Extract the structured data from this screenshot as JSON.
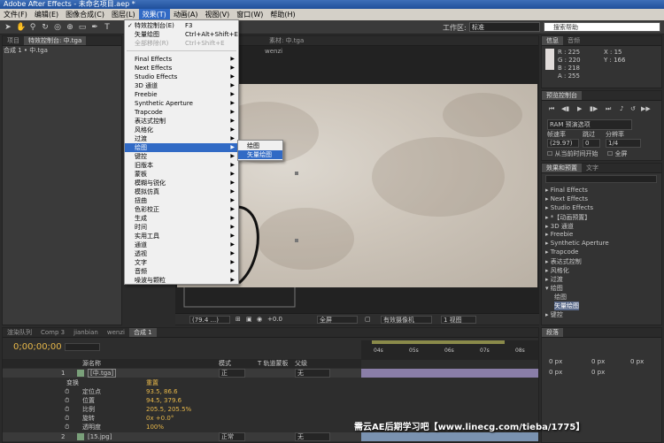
{
  "window": {
    "title": "Adobe After Effects - 未命名项目.aep *"
  },
  "menubar": {
    "items": [
      "文件(F)",
      "编辑(E)",
      "图像合成(C)",
      "图层(L)",
      "效果(T)",
      "动画(A)",
      "视图(V)",
      "窗口(W)",
      "帮助(H)"
    ]
  },
  "toolbar": {
    "workspace_label": "工作区:",
    "workspace_value": "标准",
    "search_placeholder": "搜索帮助"
  },
  "left_panel": {
    "tabs": [
      "项目",
      "特效控制台: 中.tga"
    ],
    "comp_path": "合成 1 • 中.tga"
  },
  "viewer": {
    "tabs": [
      "素材: 中.tga"
    ],
    "layer_label": "wenzi",
    "footer": {
      "zoom": "(79.4 ...)",
      "resolution": "全屏",
      "camera": "有效摄像机",
      "views": "1 视图",
      "exposure": "+0.0"
    }
  },
  "effect_menu": {
    "items": [
      {
        "label": "特效控制台(E)",
        "shortcut": "F3",
        "checked": true
      },
      {
        "label": "矢量绘图",
        "shortcut": "Ctrl+Alt+Shift+E"
      },
      {
        "label": "全部移除(R)",
        "shortcut": "Ctrl+Shift+E",
        "disabled": true
      },
      {
        "label": "Final Effects",
        "arrow": true
      },
      {
        "label": "Next Effects",
        "arrow": true
      },
      {
        "label": "Studio Effects",
        "arrow": true
      },
      {
        "label": "3D 通道",
        "arrow": true
      },
      {
        "label": "Freebie",
        "arrow": true
      },
      {
        "label": "Synthetic Aperture",
        "arrow": true
      },
      {
        "label": "Trapcode",
        "arrow": true
      },
      {
        "label": "表达式控制",
        "arrow": true
      },
      {
        "label": "风格化",
        "arrow": true
      },
      {
        "label": "过渡",
        "arrow": true
      },
      {
        "label": "绘图",
        "arrow": true,
        "highlighted": true
      },
      {
        "label": "键控",
        "arrow": true
      },
      {
        "label": "旧版本",
        "arrow": true
      },
      {
        "label": "蒙板",
        "arrow": true
      },
      {
        "label": "模糊与锐化",
        "arrow": true
      },
      {
        "label": "模拟仿真",
        "arrow": true
      },
      {
        "label": "扭曲",
        "arrow": true
      },
      {
        "label": "色彩校正",
        "arrow": true
      },
      {
        "label": "生成",
        "arrow": true
      },
      {
        "label": "时间",
        "arrow": true
      },
      {
        "label": "实用工具",
        "arrow": true
      },
      {
        "label": "通道",
        "arrow": true
      },
      {
        "label": "透视",
        "arrow": true
      },
      {
        "label": "文字",
        "arrow": true
      },
      {
        "label": "音频",
        "arrow": true
      },
      {
        "label": "噪波与颗粒",
        "arrow": true
      }
    ]
  },
  "paint_submenu": {
    "items": [
      "绘图",
      "矢量绘图"
    ]
  },
  "info_panel": {
    "tabs": [
      "信息",
      "音频"
    ],
    "r": "R : 225",
    "g": "G : 220",
    "b": "B : 218",
    "a": "A : 255",
    "x": "X : 15",
    "y": "Y : 166"
  },
  "preview_panel": {
    "tabs": [
      "预览控制台"
    ],
    "ram_option": "RAM 预演选项",
    "frame_rate_label": "帧速率",
    "skip_label": "跳过",
    "resolution_label": "分辨率",
    "frame_rate": "(29.97)",
    "skip": "0",
    "resolution": "1/4",
    "from_current": "从当前时间开始",
    "fullscreen": "全屏"
  },
  "effects_panel": {
    "tabs": [
      "效果和预置",
      "文字"
    ],
    "items": [
      "Final Effects",
      "Next Effects",
      "Studio Effects",
      "*【动画预置】",
      "3D 通道",
      "Freebie",
      "Synthetic Aperture",
      "Trapcode",
      "表达式控制",
      "风格化",
      "过渡",
      "绘图",
      "绘图",
      "矢量绘图",
      "键控"
    ]
  },
  "timeline": {
    "tabs": [
      "渲染队列",
      "Comp 3",
      "jianbian",
      "wenzi",
      "合成 1"
    ],
    "timecode": "0;00;00;00",
    "ruler": [
      "04s",
      "05s",
      "06s",
      "07s",
      "08s"
    ],
    "columns": {
      "name": "源名称",
      "mode": "模式",
      "trkmat": "T 轨道蒙板",
      "parent": "父级"
    },
    "layer1": {
      "num": "1",
      "name": "[中.tga]",
      "mode": "正",
      "parent": "无"
    },
    "transform": "变换",
    "reset": "重置",
    "props": [
      {
        "name": "定位点",
        "value": "93.5, 86.6"
      },
      {
        "name": "位置",
        "value": "94.5, 379.6"
      },
      {
        "name": "比例",
        "value": "205.5, 205.5%"
      },
      {
        "name": "旋转",
        "value": "0x +0.0°"
      },
      {
        "name": "透明度",
        "value": "100%"
      }
    ],
    "layer2": {
      "num": "2",
      "name": "[15.jpg]",
      "mode": "正常",
      "parent": "无"
    }
  },
  "paragraph_panel": {
    "tabs": [
      "段落"
    ],
    "fields": [
      "0 px",
      "0 px",
      "0 px",
      "0 px",
      "0 px"
    ]
  },
  "watermark": {
    "text": "需云AE后期学习吧【www.linecg.com/tieba/1775】"
  }
}
